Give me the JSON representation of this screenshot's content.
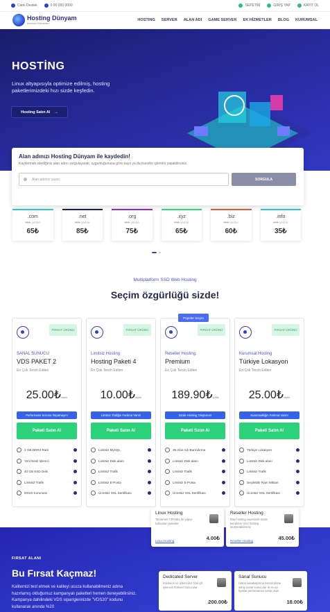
{
  "topbar": {
    "left": [
      {
        "icon": "chat-icon",
        "label": "Canlı Destek"
      },
      {
        "icon": "phone-icon",
        "label": "0 00 000 0000"
      }
    ],
    "right": [
      {
        "icon": "cart-icon",
        "label": "SEPETİM"
      },
      {
        "icon": "user-icon",
        "label": "GİRİŞ YAP"
      },
      {
        "icon": "user-plus-icon",
        "label": "KAYIT OL"
      }
    ]
  },
  "brand": {
    "name": "Hosting Dünyam",
    "tagline": "İnternet Hizmetleri"
  },
  "menu": [
    "HOSTING",
    "SERVER",
    "ALAN ADI",
    "GAME SERVER",
    "EK HİZMETLER",
    "BLOG",
    "KURUMSAL"
  ],
  "hero": {
    "title": "HOSTİNG",
    "subtitle": "Linux altyapısıyla optimize edilmiş, hosting paketlerimizdeki hızı sizde keşfedin.",
    "button": "Hosting Satın Al"
  },
  "domain": {
    "title": "Alan adınızı Hosting Dünyam ile kaydedin!",
    "desc": "Kaydetmek istediğiniz alan adını sorgulayarak, uygunluğununa göre kayıt ya da transfer işlemini yapabilirsiniz.",
    "placeholder": "Alan adınızı yazın",
    "button": "SORGULA"
  },
  "extensions": [
    {
      "name": ".com",
      "old": "80₺",
      "unit": "yerine",
      "price": "65₺",
      "color": "#2bc6d6"
    },
    {
      "name": ".net",
      "old": "00₺",
      "unit": "yerine",
      "price": "85₺",
      "color": "#1a1c5a"
    },
    {
      "name": ".org",
      "old": "85₺",
      "unit": "yerine",
      "price": "75₺",
      "color": "#8a2bd6"
    },
    {
      "name": ".xyz",
      "old": "75₺",
      "unit": "yerine",
      "price": "65₺",
      "color": "#2bd67a"
    },
    {
      "name": ".biz",
      "old": "65₺",
      "unit": "yerine",
      "price": "60₺",
      "color": "#e05a3a"
    },
    {
      "name": ".info",
      "old": "40₺",
      "unit": "yerine",
      "price": "35₺",
      "color": "#2bc6d6"
    }
  ],
  "section": {
    "subtitle": "Multiplatform SSD Web Hosting",
    "title": "Seçim özgürlüğü sizde!"
  },
  "plans": [
    {
      "badge": "FIRSAT ÜRÜNÜ",
      "popular": "",
      "category": "SANAL SUNUCU",
      "name": "VDS PAKET 2",
      "tag": "En Çok Tercih Edilen",
      "price": "25.00₺",
      "period": "/aylık",
      "promo": "Performans Sorunu Yaşamayın!",
      "buy": "Paketi Satın Al",
      "features": [
        "2 GB DDR4 Ram",
        "Yeni Nesil İşlemci",
        "40 GB SSD Disk",
        "Limitsiz Trafik",
        "DDoS Koruması"
      ]
    },
    {
      "badge": "FIRSAT ÜRÜNÜ",
      "popular": "",
      "category": "Limitsiz Hosting",
      "name": "Hosting Paketi 4",
      "tag": "En Çok Tercih Edilen",
      "price": "10.00₺",
      "period": "/aylık",
      "promo": "Limitsiz Trafiğin Farkına Varın!",
      "buy": "Paketi Satın Al",
      "features": [
        "Limitsiz MySQL",
        "Limitsiz Disk alanı",
        "Limitsiz Trafik",
        "Limitsiz E-Posta",
        "Ücretsiz SSL Sertifikası"
      ]
    },
    {
      "badge": "FIRSAT ÜRÜNÜ",
      "popular": "Popüler Seçim",
      "category": "Reseller Hosting",
      "name": "Premium",
      "tag": "En Çok Tercih Edilen",
      "price": "189.90₺",
      "period": "/yıllık",
      "promo": "Sizde Hosting Oluşturun!",
      "buy": "Paketi Satın Al",
      "features": [
        "35 Alan Adı Barındırma",
        "Limitsiz Disk alanı",
        "Limitsiz Trafik",
        "Limitsiz E-Posta",
        "Ücretsiz SSL Sertifikası"
      ]
    },
    {
      "badge": "FIRSAT ÜRÜNÜ",
      "popular": "",
      "category": "Kurumsal Hosting",
      "name": "Türkiye Lokasyon",
      "tag": "En Çok Tercih Edilen",
      "price": "25.00₺",
      "period": "/aylık",
      "promo": "Kurumsallığın Farkına Varın!",
      "buy": "Paketi Satın Al",
      "features": [
        "Türkiye Lokasyon",
        "Limitsiz Disk alanı",
        "Limitsiz Trafik",
        "Seçilebilir Ram Miktarı",
        "Ücretsiz SSL Sertifikası"
      ]
    }
  ],
  "opportunity": {
    "label": "FIRSAT ALANI",
    "title": "Bu Fırsat Kaçmaz!",
    "text": "Kalitemizi test etmek ve kaliteyi ucuza kullanabilmeniz adına hazırlamış olduğumuz kampanyalı paketleri hemen deneyebilirsiniz. Kampanya dahilindeki VDS sipariş̧lerinizde \"VDS20\" kodunu kullanarak anında %20"
  },
  "mini_cards": [
    {
      "title": "Linux Hosting",
      "desc": "Tamamen CPANEL ile yapıyı kullanılan paketler",
      "link": "Linux Hosting",
      "price": "4.00₺"
    },
    {
      "title": "Reseller Hosting",
      "desc": "Bayi hosting sayesinde sizde kendinize özel hosting oluşturabilirsiniz",
      "link": "Reseller Hosting",
      "price": "45.00₺"
    },
    {
      "title": "Dedicated Server",
      "desc": "Intelxeon ve işlemcileri özel çift işlemcili Fiziksel Sunucular",
      "link": "",
      "price": "200.00₺"
    },
    {
      "title": "Sanal Sunucu",
      "desc": "Üstün sanallaştırma teknolojisine sahip sanal sunucular ile en iyi fiyatlar performansa sahip olun!",
      "link": "",
      "price": "18.00₺"
    }
  ]
}
